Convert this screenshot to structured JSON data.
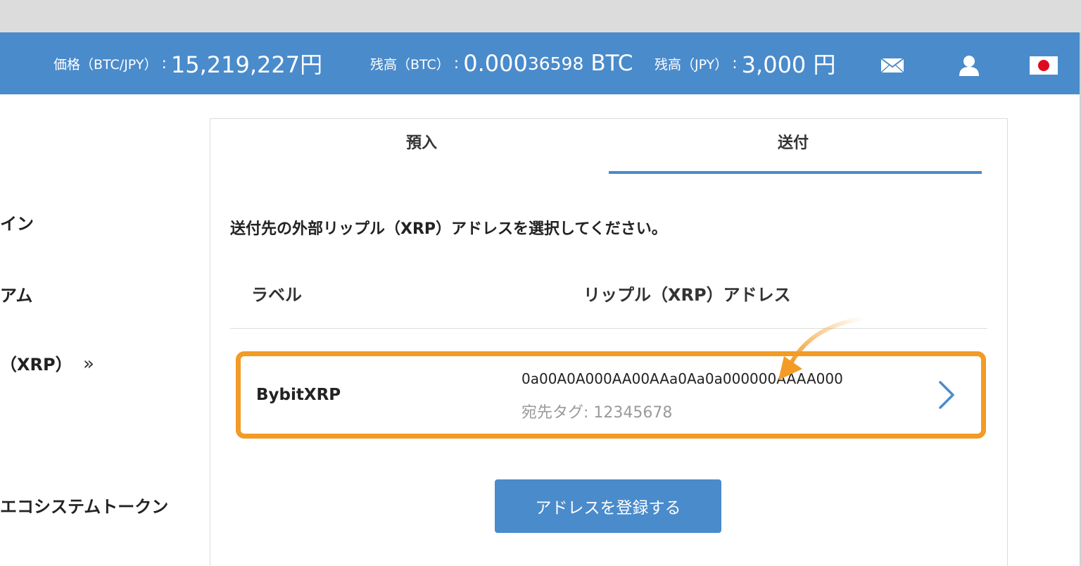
{
  "header": {
    "price_label": "価格（BTC/JPY）",
    "price_value": "15,219,227円",
    "btc_balance_label": "残高（BTC）",
    "btc_balance_main": "0.000",
    "btc_balance_small": "36598",
    "btc_balance_unit": "BTC",
    "jpy_balance_label": "残高（JPY）",
    "jpy_balance_value": "3,000 円",
    "colon": ":",
    "icons": [
      "mail-icon",
      "user-icon",
      "japan-flag-icon"
    ],
    "colors": {
      "bar": "#4a8bcb",
      "highlight": "#f29b25"
    }
  },
  "sidebar": {
    "items": [
      {
        "label": "イン"
      },
      {
        "label": "アム"
      },
      {
        "label": "（XRP）",
        "arrow": "»"
      },
      {
        "label": "エコシステムトークン"
      }
    ]
  },
  "panel": {
    "tabs": [
      {
        "label": "預入",
        "active": false
      },
      {
        "label": "送付",
        "active": true
      }
    ],
    "instruction": "送付先の外部リップル（XRP）アドレスを選択してください。",
    "columns": {
      "label": "ラベル",
      "address": "リップル（XRP）アドレス"
    },
    "rows": [
      {
        "label": "BybitXRP",
        "address": "0a00A0A000AA00AAa0Aa0a000000AAAA000",
        "tag": "宛先タグ: 12345678"
      }
    ],
    "register_button": "アドレスを登録する"
  }
}
